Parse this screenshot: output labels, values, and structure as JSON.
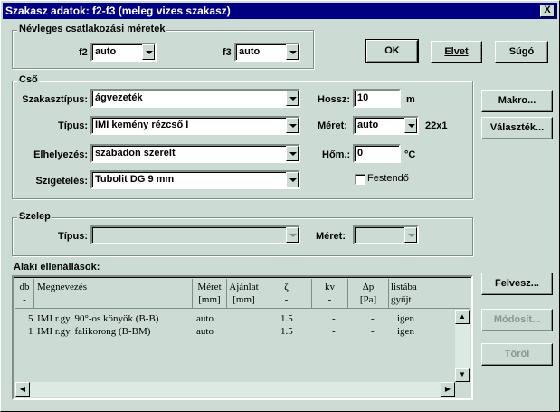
{
  "window": {
    "title": "Szakasz adatok: f2-f3 (meleg vizes szakasz)",
    "close_label": "X"
  },
  "nominal": {
    "group_label": "Névleges csatlakozási méretek",
    "f2_label": "f2",
    "f2_value": "auto",
    "f3_label": "f3",
    "f3_value": "auto"
  },
  "buttons": {
    "ok": "OK",
    "cancel": "Elvet",
    "help": "Súgó",
    "macro": "Makro...",
    "choice": "Választék...",
    "add": "Felvesz...",
    "modify": "Módosít...",
    "delete": "Töröl"
  },
  "pipe": {
    "group_label": "Cső",
    "section_type_label": "Szakasztípus:",
    "section_type_value": "ágvezeték",
    "type_label": "Típus:",
    "type_value": "IMI kemény rézcső I",
    "placement_label": "Elhelyezés:",
    "placement_value": "szabadon szerelt",
    "insulation_label": "Szigetelés:",
    "insulation_value": "Tubolit DG 9 mm",
    "length_label": "Hossz:",
    "length_value": "10",
    "length_unit": "m",
    "size_label": "Méret:",
    "size_value": "auto",
    "size_extra": "22x1",
    "temp_label": "Hőm.:",
    "temp_value": "0",
    "temp_unit": "°C",
    "paint_label": "Festendő"
  },
  "valve": {
    "group_label": "Szelep",
    "type_label": "Típus:",
    "type_value": "",
    "size_label": "Méret:",
    "size_value": ""
  },
  "fittings": {
    "label": "Alaki ellenállások:",
    "headers": [
      {
        "l1": "db",
        "l2": "-"
      },
      {
        "l1": "Megnevezés",
        "l2": ""
      },
      {
        "l1": "Méret",
        "l2": "[mm]"
      },
      {
        "l1": "Ajánlat",
        "l2": "[mm]"
      },
      {
        "l1": "ζ",
        "l2": "-"
      },
      {
        "l1": "kv",
        "l2": "-"
      },
      {
        "l1": "Δp",
        "l2": "[Pa]"
      },
      {
        "l1": "listába",
        "l2": "gyűjt"
      }
    ],
    "rows": [
      {
        "db": "5",
        "name": "IMI r.gy. 90°-os könyök (B-B)",
        "size": "auto",
        "offer": "",
        "zeta": "1.5",
        "kv": "-",
        "dp": "-",
        "list": "igen"
      },
      {
        "db": "1",
        "name": "IMI r.gy. falikorong (B-BM)",
        "size": "auto",
        "offer": "",
        "zeta": "1.5",
        "kv": "-",
        "dp": "-",
        "list": "igen"
      }
    ]
  },
  "colors": {
    "titlebar": "#000080",
    "face": "#ccdcd4"
  }
}
